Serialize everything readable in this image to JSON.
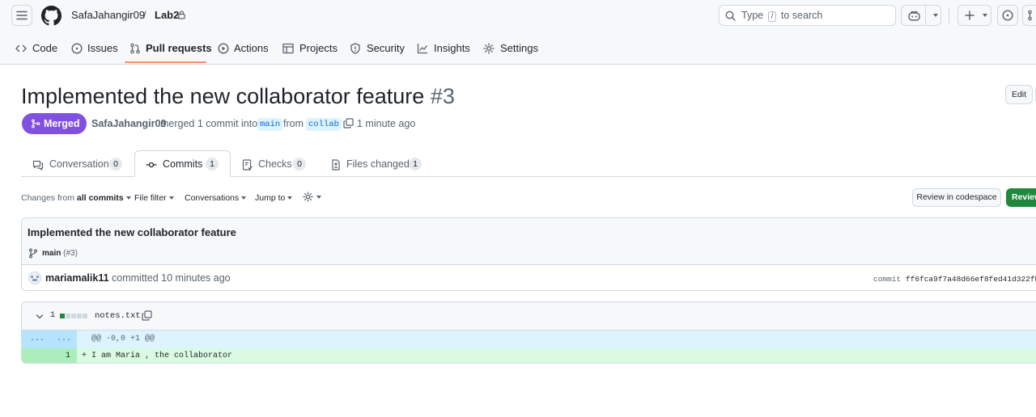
{
  "header": {
    "owner": "SafaJahangir09",
    "separator": "/",
    "repo": "Lab2",
    "search": {
      "prefix": "Type",
      "key": "/",
      "suffix": "to search"
    }
  },
  "repo_nav": [
    {
      "label": "Code",
      "icon": "code-icon"
    },
    {
      "label": "Issues",
      "icon": "issue-icon"
    },
    {
      "label": "Pull requests",
      "icon": "pull-request-icon",
      "active": true
    },
    {
      "label": "Actions",
      "icon": "play-icon"
    },
    {
      "label": "Projects",
      "icon": "table-icon"
    },
    {
      "label": "Security",
      "icon": "shield-icon"
    },
    {
      "label": "Insights",
      "icon": "graph-icon"
    },
    {
      "label": "Settings",
      "icon": "gear-icon"
    }
  ],
  "pr": {
    "title": "Implemented the new collaborator feature",
    "number": "#3",
    "status": "Merged",
    "author": "SafaJahangir09",
    "action": "merged 1 commit into",
    "base_branch": "main",
    "from_word": "from",
    "head_branch": "collab",
    "time": "1 minute ago",
    "edit_label": "Edit"
  },
  "tabs": [
    {
      "label": "Conversation",
      "count": "0",
      "icon": "comment-icon"
    },
    {
      "label": "Commits",
      "count": "1",
      "icon": "commit-icon",
      "active": true
    },
    {
      "label": "Checks",
      "count": "0",
      "icon": "checklist-icon"
    },
    {
      "label": "Files changed",
      "count": "1",
      "icon": "file-diff-icon"
    }
  ],
  "toolbar": {
    "changes_from_prefix": "Changes from",
    "changes_from_value": "all commits",
    "file_filter": "File filter",
    "conversations": "Conversations",
    "jump_to": "Jump to",
    "codespace_button": "Review in codespace",
    "review_button": "Review"
  },
  "commit": {
    "title": "Implemented the new collaborator feature",
    "branch": "main",
    "pr_ref": "(#3)",
    "author": "mariamalik11",
    "committed_text": "committed 10 minutes ago",
    "sha_label": "commit",
    "sha": "ff6fca9f7a48d66ef8fed41d322fb"
  },
  "diff": {
    "changes": "1",
    "filename": "notes.txt",
    "hunk_left": "...",
    "hunk_right": "...",
    "hunk_header": "@@ -0,0 +1 @@",
    "line_number": "1",
    "line_sign": "+",
    "line_content": "I am Maria , the collaborator"
  },
  "colors": {
    "merged": "#8250df",
    "review_green": "#1f883d",
    "accent_blue": "#0969da",
    "active_tab_underline": "#fd8c73"
  }
}
